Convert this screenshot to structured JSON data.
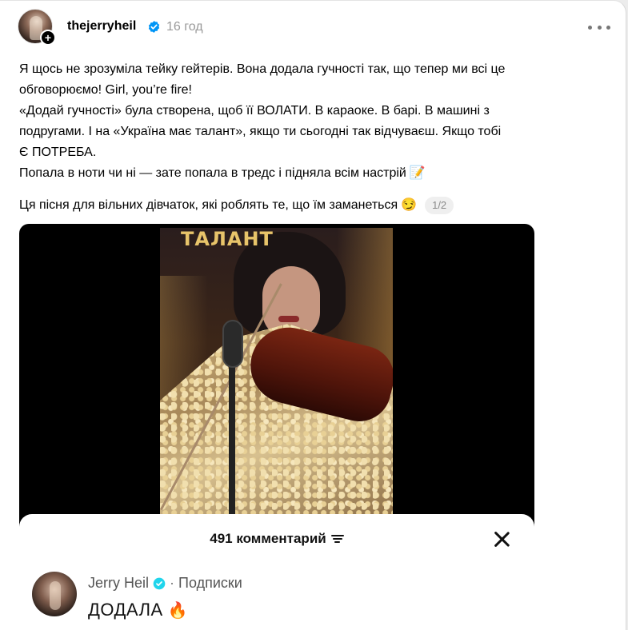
{
  "post": {
    "username": "thejerryheil",
    "timestamp": "16 год",
    "paragraph": "Я щось не зрозуміла тейку гейтерів. Вона додала гучності так, що тепер ми всі це\nобговорюємо! Girl, you’re fire!\n«Додай гучності» була створена, щоб її ВОЛАТИ. В караоке. В барі. В машині з\nподругами. І на «Україна має талант», якщо ти сьогодні так відчуваєш. Якщо тобі\nЄ ПОТРЕБА.\nПопала в ноти чи ні — зате попала в тредс і підняла всім настрій",
    "paragraph_emoji": "📝",
    "line2": "Ця пісня для вільних дівчаток, які роблять те, що їм заманеться",
    "line2_emoji": "😏",
    "pager": "1/2"
  },
  "media": {
    "tv_logo": "ТАЛАНТ",
    "comments_title": "491 комментарий",
    "comment": {
      "author": "Jerry Heil",
      "separator": "·",
      "tag": "Подписки",
      "text": "ДОДАЛА",
      "emoji": "🔥"
    }
  },
  "colors": {
    "verified": "#0095f6",
    "timestamp": "#999999",
    "pager_bg": "#efefef"
  },
  "icons": {
    "verified": "verified-badge-icon",
    "more": "more-dots-icon",
    "follow_plus": "plus-icon",
    "filter": "filter-icon",
    "close": "close-icon"
  }
}
